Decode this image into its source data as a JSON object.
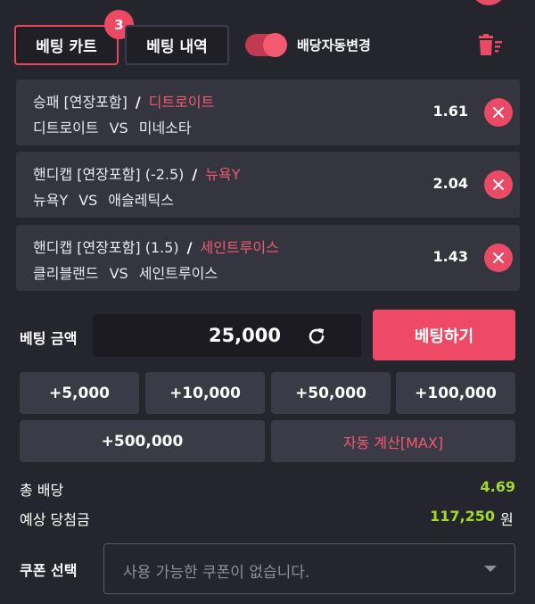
{
  "header": {
    "tab_cart_label": "베팅 카트",
    "tab_cart_badge": "3",
    "tab_history_label": "베팅 내역",
    "auto_odds_label": "배당자동변경",
    "auto_odds_enabled": true
  },
  "bets": [
    {
      "market": "승패 [연장포함]",
      "selection": "디트로이트",
      "home": "디트로이트",
      "vs": "VS",
      "away": "미네소타",
      "odds": "1.61"
    },
    {
      "market": "핸디캡 [연장포함]  (-2.5)",
      "selection": "뉴욕Y",
      "home": "뉴욕Y",
      "vs": "VS",
      "away": "애슬레틱스",
      "odds": "2.04"
    },
    {
      "market": "핸디캡 [연장포함]  (1.5)",
      "selection": "세인트루이스",
      "home": "클리블랜드",
      "vs": "VS",
      "away": "세인트루이스",
      "odds": "1.43"
    }
  ],
  "amount": {
    "label": "베팅 금액",
    "value": "25,000",
    "submit_label": "베팅하기"
  },
  "quick_amounts": [
    "+5,000",
    "+10,000",
    "+50,000",
    "+100,000",
    "+500,000"
  ],
  "auto_calc_label": "자동 계산[MAX]",
  "summary": {
    "total_odds_label": "총 배당",
    "total_odds_value": "4.69",
    "expected_win_label": "예상 당첨금",
    "expected_win_value": "117,250",
    "currency": "원"
  },
  "coupon": {
    "label": "쿠폰 선택",
    "placeholder": "사용 가능한 쿠폰이 없습니다."
  },
  "colors": {
    "accent": "#ea4a64",
    "positive": "#a3d92b",
    "background": "#25252d"
  }
}
